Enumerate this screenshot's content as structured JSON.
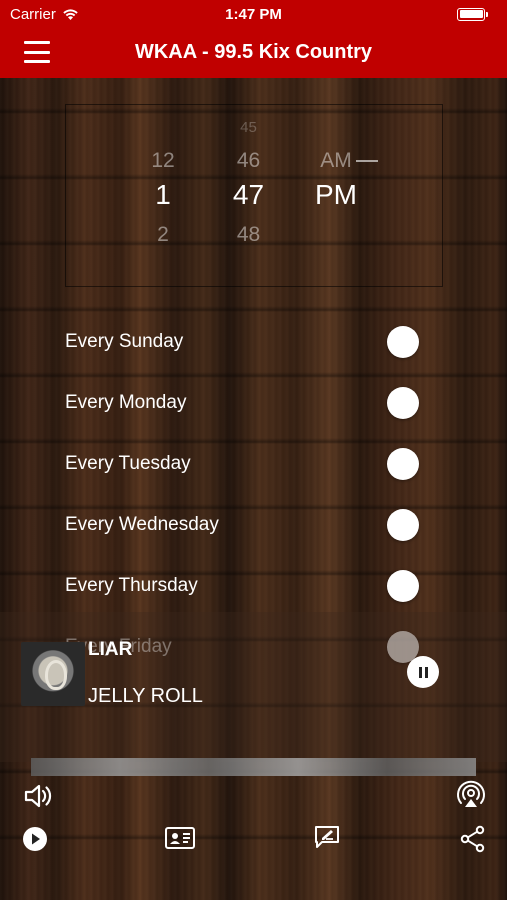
{
  "status_bar": {
    "carrier": "Carrier",
    "time": "1:47 PM"
  },
  "nav": {
    "title": "WKAA - 99.5 Kix Country",
    "menu_icon": "hamburger-icon"
  },
  "time_picker": {
    "hour": {
      "above2": "",
      "above": "12",
      "selected": "1",
      "below": "2"
    },
    "minute": {
      "above2": "45",
      "above": "46",
      "selected": "47",
      "below": "48"
    },
    "ampm": {
      "above": "AM",
      "selected": "PM"
    }
  },
  "alarm_days": [
    {
      "label": "Every Sunday"
    },
    {
      "label": "Every Monday"
    },
    {
      "label": "Every Tuesday"
    },
    {
      "label": "Every Wednesday"
    },
    {
      "label": "Every Thursday"
    },
    {
      "label": "Every Friday"
    }
  ],
  "now_playing": {
    "title": "LIAR",
    "artist": "JELLY ROLL",
    "state": "playing"
  },
  "controls": {
    "volume_icon": "speaker-icon",
    "airplay_icon": "airplay-icon",
    "play_icon": "play-icon",
    "contact_icon": "contact-card-icon",
    "feedback_icon": "feedback-icon",
    "share_icon": "share-icon"
  },
  "colors": {
    "brand": "#c00000",
    "toggle": "#ffffff"
  }
}
